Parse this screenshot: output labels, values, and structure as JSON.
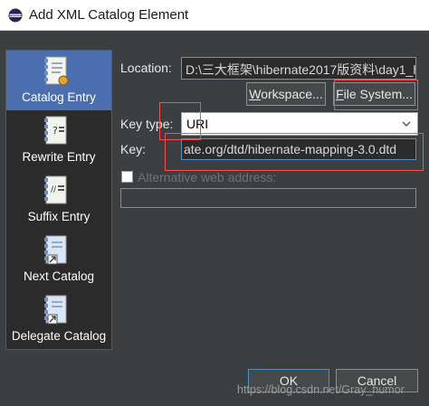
{
  "window": {
    "title": "Add XML Catalog Element"
  },
  "sidebar": {
    "items": [
      {
        "label": "Catalog Entry",
        "icon": "catalog-entry-icon"
      },
      {
        "label": "Rewrite Entry",
        "icon": "rewrite-entry-icon"
      },
      {
        "label": "Suffix Entry",
        "icon": "suffix-entry-icon"
      },
      {
        "label": "Next Catalog",
        "icon": "next-catalog-icon"
      },
      {
        "label": "Delegate Catalog",
        "icon": "delegate-catalog-icon"
      }
    ],
    "selected": "Catalog Entry"
  },
  "form": {
    "location_label": "Location:",
    "location_value": "D:\\三大框架\\hibernate2017版资料\\day1_h",
    "workspace_button": "Workspace...",
    "workspace_mnemonic": "W",
    "workspace_rest": "orkspace...",
    "filesystem_button": "File System...",
    "filesystem_mnemonic": "F",
    "filesystem_rest": "ile System...",
    "key_type_label": "Key type:",
    "key_type_value": "URI",
    "key_label": "Key:",
    "key_value": "ate.org/dtd/hibernate-mapping-3.0.dtd",
    "alt_web_address_label": "Alternative web address:",
    "alt_web_address_checked": false,
    "alt_web_address_value": ""
  },
  "footer": {
    "ok_label": "OK",
    "cancel_label": "Cancel"
  },
  "watermark": "https://blog.csdn.net/Gray_humor",
  "colors": {
    "background": "#3c3f41",
    "selection": "#4b6eaf",
    "focus_border": "#4b8fd9",
    "annotation": "#ff4d4d"
  }
}
